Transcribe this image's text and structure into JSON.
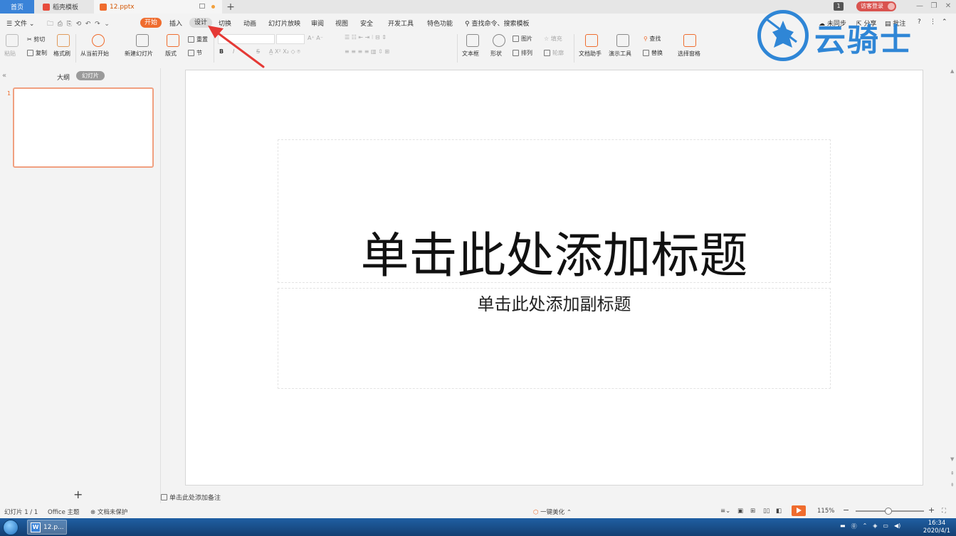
{
  "tabs": {
    "home": "首页",
    "template": "稻壳模板",
    "file": "12.pptx",
    "add": "+"
  },
  "topright": {
    "window_count": "1",
    "guest_login": "访客登录"
  },
  "menu": {
    "file": "文件",
    "items": [
      "开始",
      "插入",
      "设计",
      "切换",
      "动画",
      "幻灯片放映",
      "审阅",
      "视图",
      "安全",
      "开发工具",
      "特色功能"
    ],
    "search": "查找命令、搜索模板",
    "sync": "未同步",
    "share": "分享",
    "comment": "批注",
    "help": "?"
  },
  "ribbon": {
    "paste": "粘贴",
    "cut": "剪切",
    "copy": "复制",
    "format_painter": "格式刷",
    "from_current": "从当前开始",
    "new_slide": "新建幻灯片",
    "layout": "版式",
    "reset": "重置",
    "section": "节",
    "bold": "B",
    "italic": "I",
    "strike": "S",
    "textbox": "文本框",
    "shape": "形状",
    "picture": "图片",
    "fill": "填充",
    "arrange": "排列",
    "outline": "轮廓",
    "doc_helper": "文档助手",
    "present_tools": "演示工具",
    "find": "查找",
    "replace": "替换",
    "selection_pane": "选择窗格"
  },
  "logo": {
    "text": "云骑士"
  },
  "leftpane": {
    "outline_tab": "大纲",
    "slides_tab": "幻灯片",
    "slide_number": "1",
    "add_icon": "+"
  },
  "slide": {
    "title": "单击此处添加标题",
    "subtitle": "单击此处添加副标题"
  },
  "notes": {
    "placeholder": "单击此处添加备注"
  },
  "status": {
    "slide_count": "幻灯片 1 / 1",
    "theme": "Office 主题",
    "protection": "文档未保护",
    "beautify": "一键美化",
    "zoom": "115%",
    "zoom_fraction": 0.48
  },
  "taskbar": {
    "app_label": "12.p...",
    "time": "16:34",
    "date": "2020/4/1"
  },
  "colors": {
    "accent": "#ef6c2e",
    "home_tab": "#3a83d8",
    "logo": "#2f86d6",
    "arrow": "#e53935"
  }
}
